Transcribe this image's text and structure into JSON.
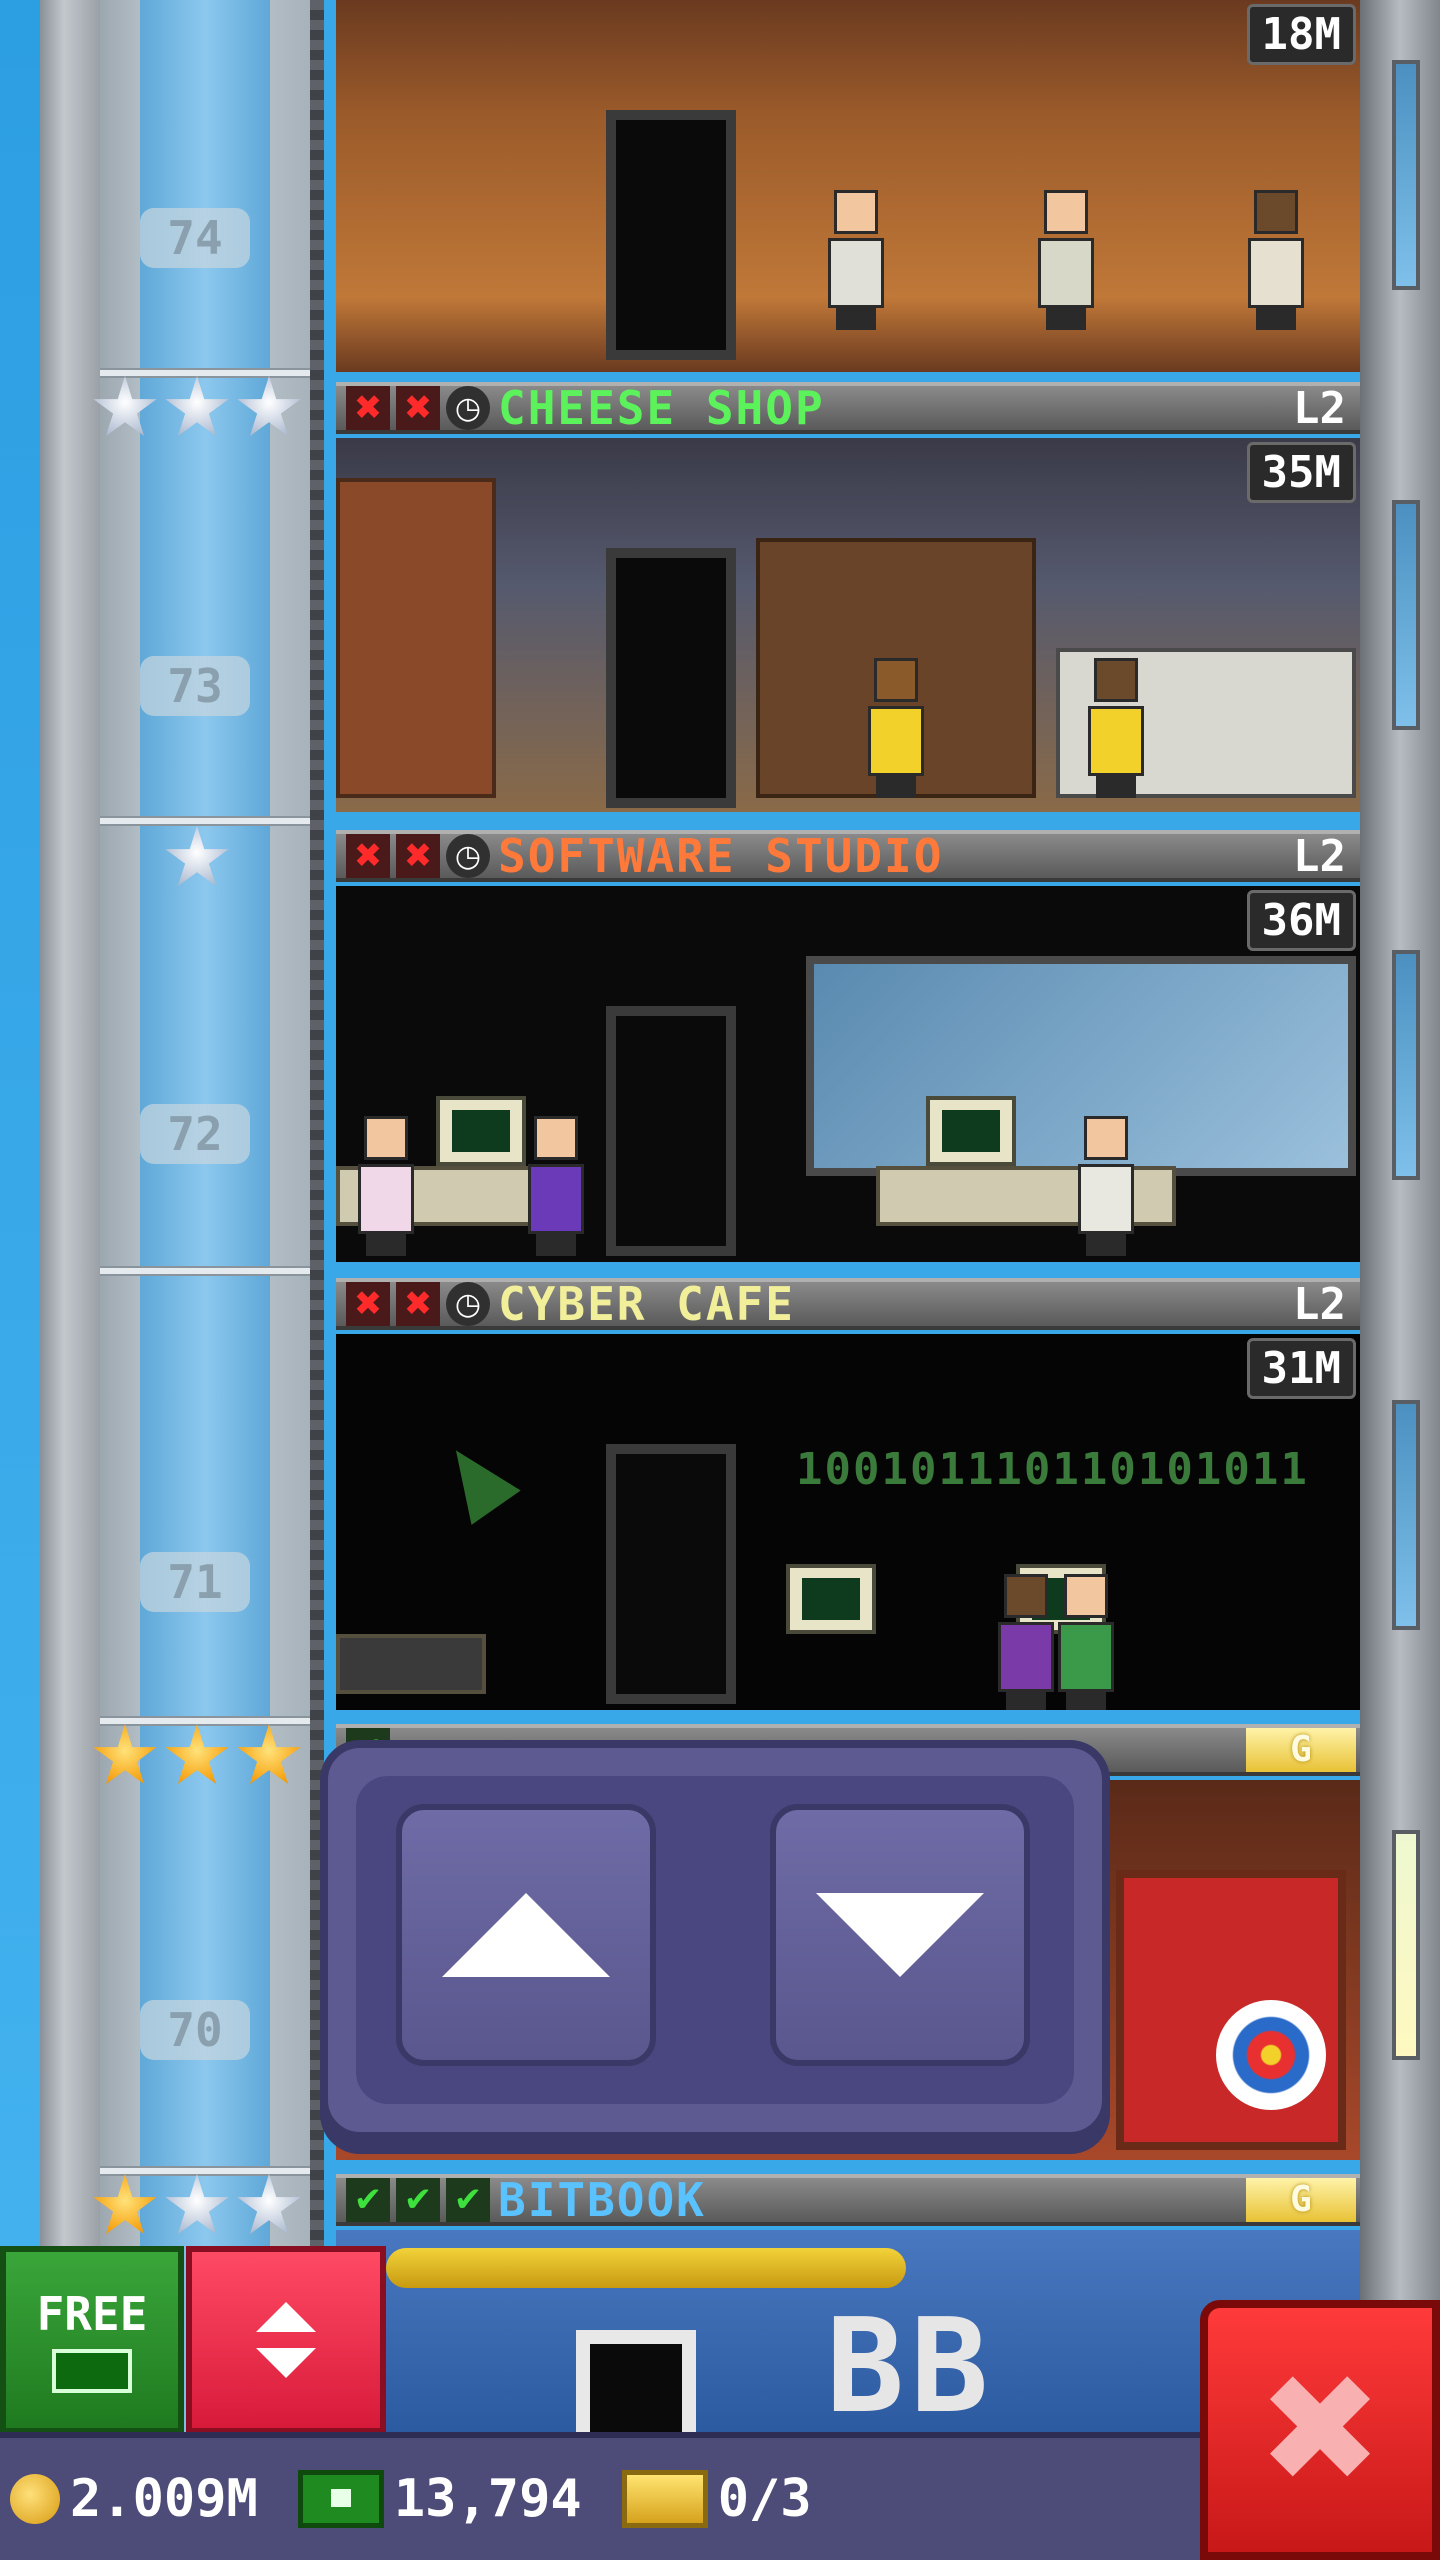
{
  "floors": [
    {
      "number": "74",
      "room": "",
      "price": "18M"
    },
    {
      "number": "73",
      "room": "CHEESE SHOP",
      "level": "L2",
      "price": "35M",
      "name_color": "#5cf25c",
      "stars": [
        "silver",
        "silver",
        "silver"
      ]
    },
    {
      "number": "72",
      "room": "SOFTWARE STUDIO",
      "level": "L2",
      "price": "36M",
      "name_color": "#ff7a3a",
      "stars": [
        "silver"
      ]
    },
    {
      "number": "71",
      "room": "CYBER CAFE",
      "level": "L2",
      "price": "31M",
      "name_color": "#f2ef9a"
    },
    {
      "number": "70",
      "room": "",
      "gold_badge": "G",
      "stars": [
        "gold",
        "gold",
        "gold"
      ]
    },
    {
      "number": "",
      "room": "BITBOOK",
      "gold_badge": "G",
      "name_color": "#5ac2ff",
      "stars": [
        "gold",
        "silver",
        "silver"
      ]
    }
  ],
  "status_icons": {
    "x": "✖",
    "check": "✔",
    "clock": "◷"
  },
  "cyber_cafe_binary": "100101110110101011",
  "elevator_panel": {
    "up_icon": "arrow-up-icon",
    "down_icon": "arrow-down-icon"
  },
  "buttons": {
    "free_label": "FREE",
    "close_glyph": "✖"
  },
  "lobby_sign": "BB",
  "currency": {
    "coins": "2.009M",
    "bux": "13,794",
    "tickets": "0/3"
  },
  "colors": {
    "sky": "#38a8e8",
    "panel": "#5d5a92",
    "free": "#2a8f2a",
    "elevator": "#e8223e",
    "close": "#e02424"
  }
}
